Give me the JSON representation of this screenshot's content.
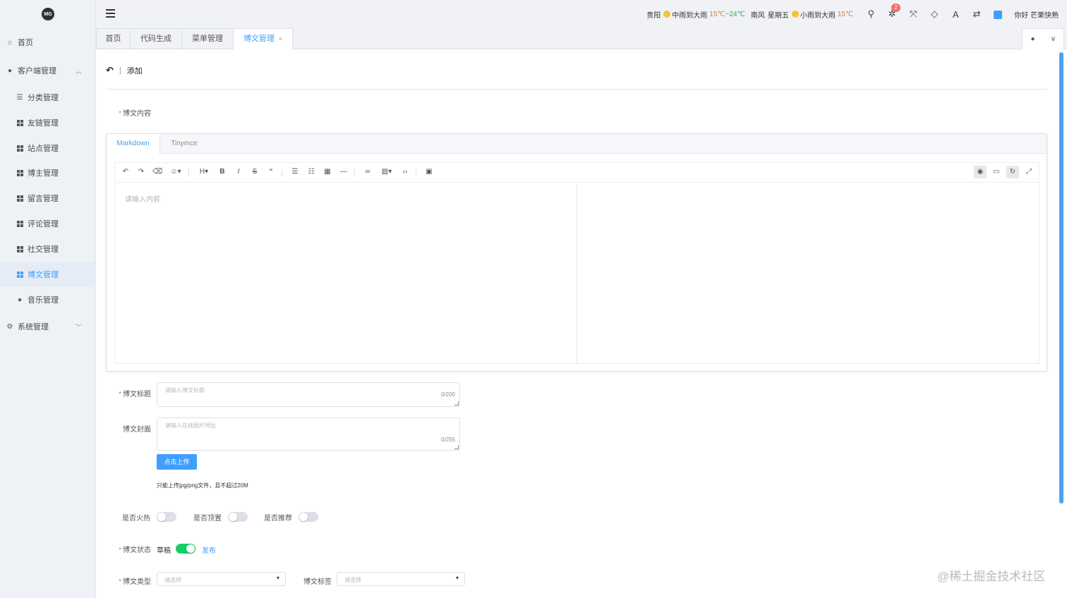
{
  "logo": {
    "text": "MG"
  },
  "sidebar": {
    "items": [
      {
        "label": "首页",
        "icon": "home-icon"
      },
      {
        "label": "客户端管理",
        "icon": "client-icon"
      },
      {
        "label": "分类管理",
        "icon": "list-icon"
      },
      {
        "label": "友链管理",
        "icon": "grid-icon"
      },
      {
        "label": "站点管理",
        "icon": "grid-icon"
      },
      {
        "label": "博主管理",
        "icon": "grid-icon"
      },
      {
        "label": "留言管理",
        "icon": "grid-icon"
      },
      {
        "label": "评论管理",
        "icon": "grid-icon"
      },
      {
        "label": "社交管理",
        "icon": "grid-icon"
      },
      {
        "label": "博文管理",
        "icon": "grid-icon"
      },
      {
        "label": "音乐管理",
        "icon": "music-icon"
      },
      {
        "label": "系统管理",
        "icon": "gear-icon"
      }
    ]
  },
  "header": {
    "city": "贵阳",
    "weather1": "中雨到大雨",
    "temp1a": "15℃",
    "temp1sep": "~",
    "temp1b": "24℃",
    "wind": "南风",
    "weekday": "星期五",
    "weather2": "小雨到大雨",
    "temp2": "15℃",
    "notification_count": "2",
    "greeting": "你好 芒果快熟"
  },
  "tabs": [
    {
      "label": "首页"
    },
    {
      "label": "代码生成"
    },
    {
      "label": "菜单管理"
    },
    {
      "label": "博文管理",
      "close": "×"
    }
  ],
  "page": {
    "title": "添加",
    "content_label": "博文内容",
    "editor_tabs": [
      "Markdown",
      "Tinymce"
    ],
    "editor_placeholder": "请输入内容",
    "title_label": "博文标题",
    "title_placeholder": "请输入博文标题",
    "title_count": "0/200",
    "cover_label": "博文封面",
    "cover_placeholder": "请输入在线图片地址",
    "cover_count": "0/255",
    "upload_button": "点击上传",
    "upload_hint": "只能上传jpg/png文件，且不超过20M",
    "hot_label": "是否火热",
    "top_label": "是否顶置",
    "recommend_label": "是否推荐",
    "status_label": "博文状态",
    "status_off": "草稿",
    "status_on": "发布",
    "type_label": "博文类型",
    "type_placeholder": "请选择",
    "tag_label": "博文标签",
    "tag_placeholder": "请选择"
  },
  "toggles": {
    "hot": false,
    "top": false,
    "recommend": false,
    "status": true
  },
  "colors": {
    "accent": "#409eff",
    "switch_on": "#13ce66",
    "required": "#f56c6c"
  },
  "watermark": "@稀土掘金技术社区"
}
